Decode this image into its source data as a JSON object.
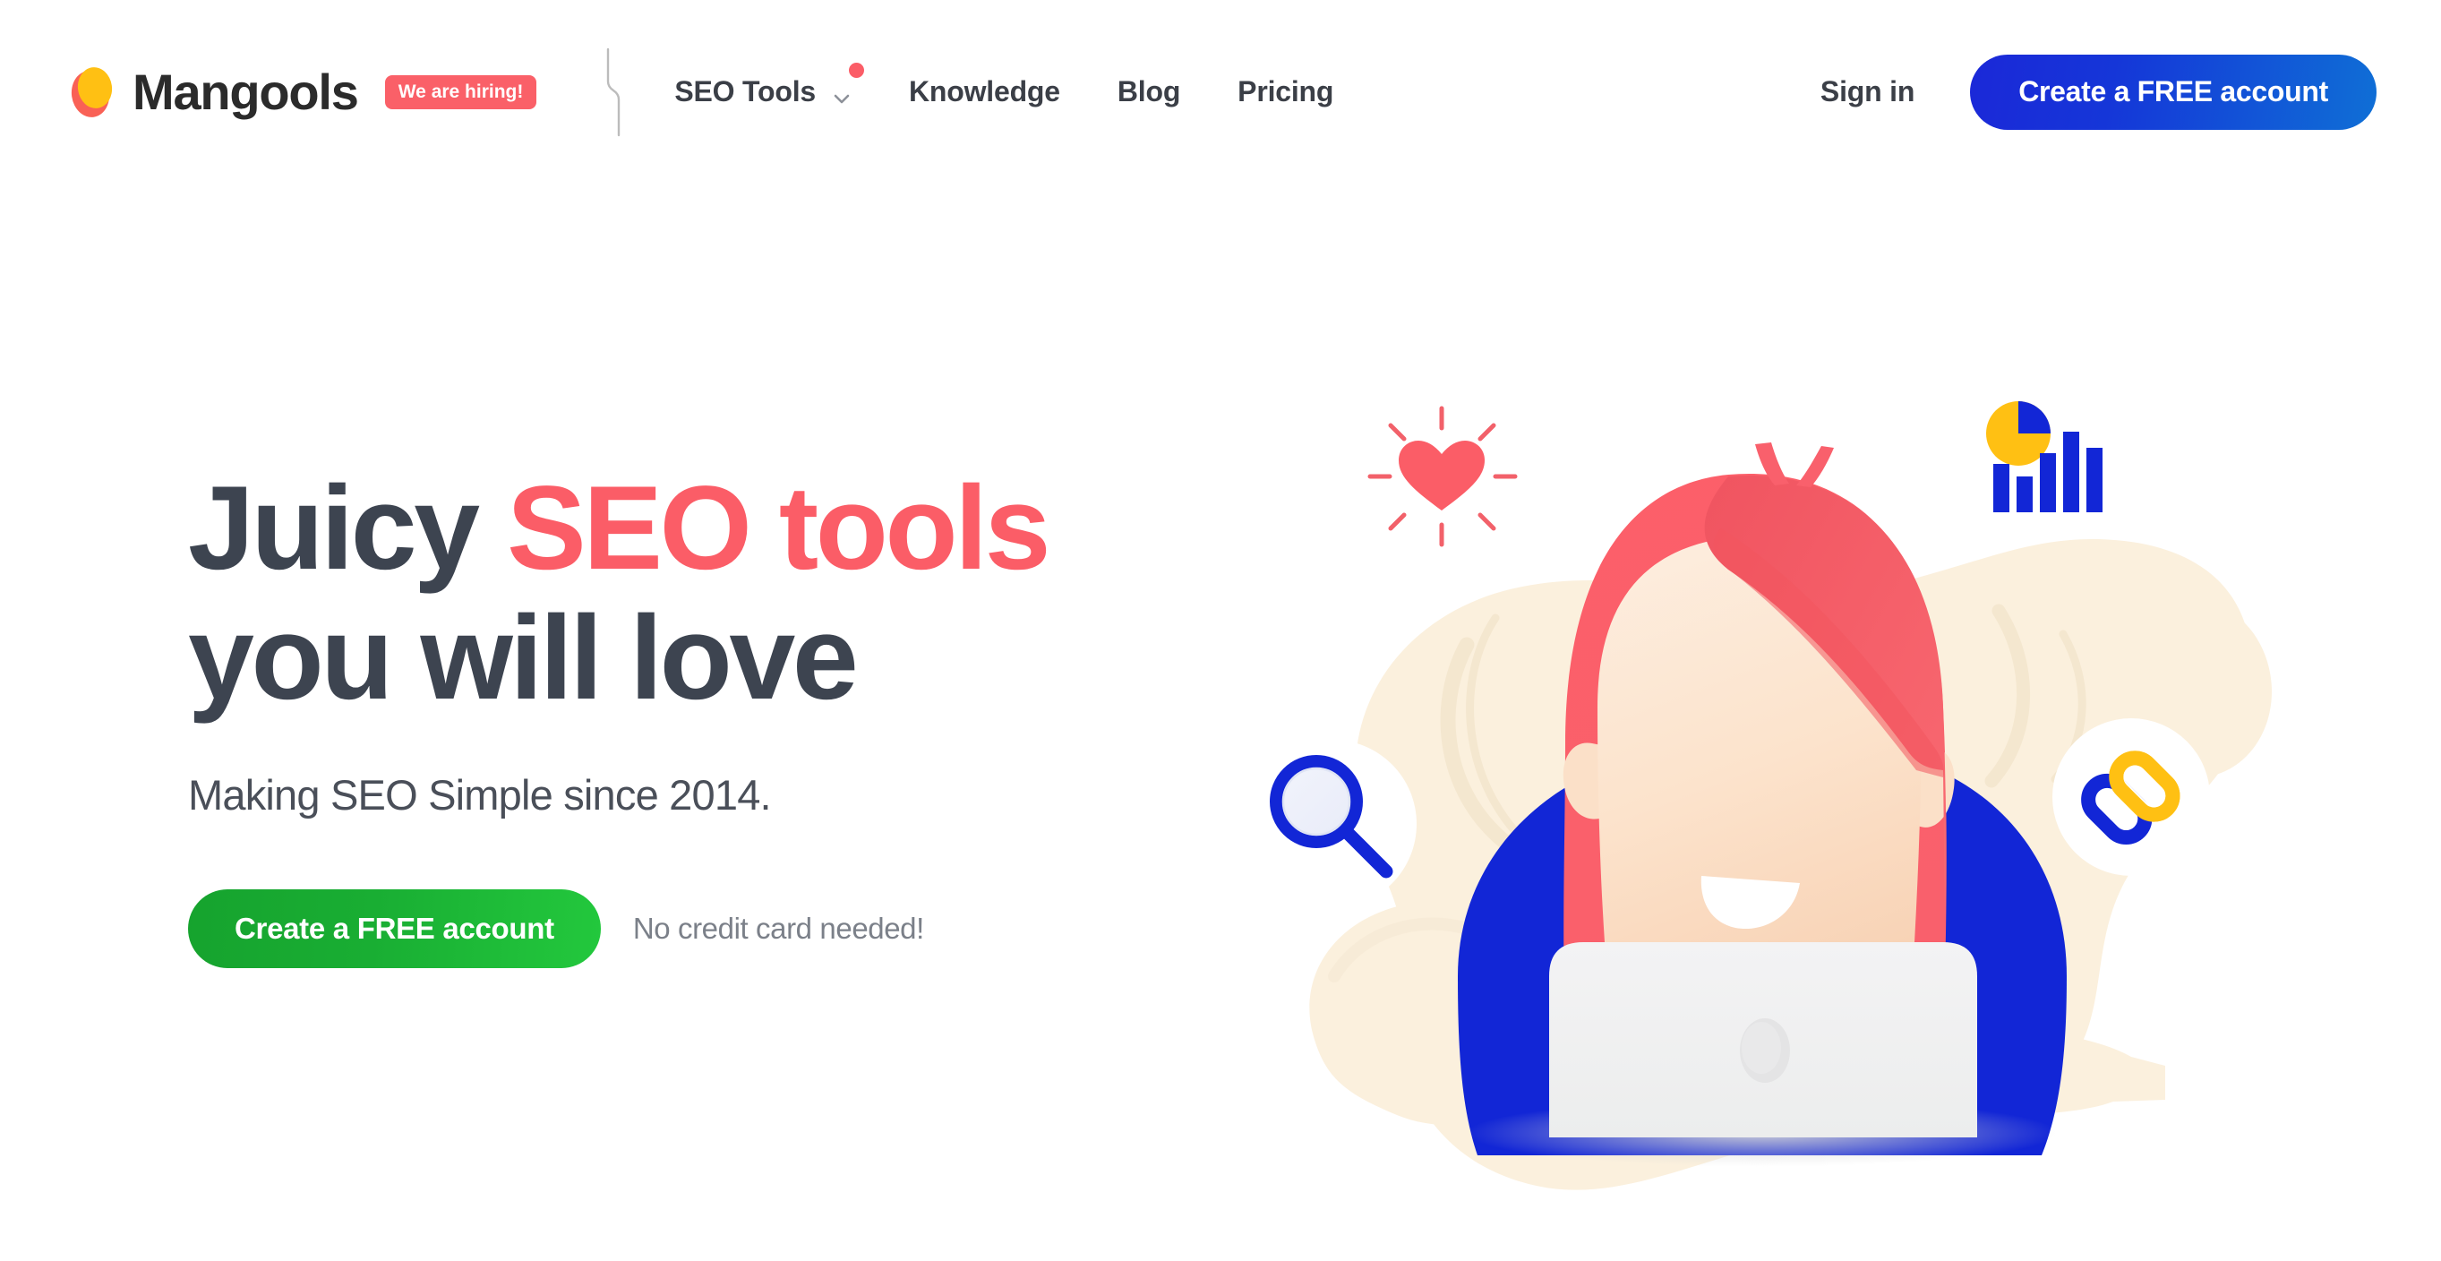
{
  "header": {
    "brand": {
      "name": "Mangools",
      "logo_icon": "mango-logo-icon",
      "badge": "We are hiring!"
    },
    "divider_icon": "zigzag-divider-icon",
    "nav": [
      {
        "label": "SEO Tools",
        "has_dropdown": true,
        "dropdown_icon": "chevron-down-icon",
        "dot_icon": "notification-dot-icon"
      },
      {
        "label": "Knowledge",
        "has_dropdown": false
      },
      {
        "label": "Blog",
        "has_dropdown": false
      },
      {
        "label": "Pricing",
        "has_dropdown": false
      }
    ],
    "signin_label": "Sign in",
    "cta_label": "Create a FREE account"
  },
  "hero": {
    "headline_part1": "Juicy ",
    "headline_accent": "SEO tools",
    "headline_line2": "you will love",
    "subheadline": "Making SEO Simple since 2014.",
    "cta_label": "Create a FREE account",
    "cta_note": "No credit card needed!"
  },
  "illustration": {
    "name": "woman-at-laptop-illustration",
    "icons": [
      {
        "name": "heart-icon",
        "position": "top-left"
      },
      {
        "name": "chart-icon",
        "position": "top-right"
      },
      {
        "name": "magnifier-icon",
        "position": "left"
      },
      {
        "name": "link-icon",
        "position": "right"
      }
    ]
  },
  "colors": {
    "accent_red": "#fb5d67",
    "brand_blue": "#1a2ad8",
    "brand_yellow": "#ffc013",
    "cta_green": "#19ae33",
    "text_dark": "#3d4450",
    "text_muted": "#7b8089",
    "cream": "#fbf0dd",
    "skin": "#fbe3cf"
  }
}
